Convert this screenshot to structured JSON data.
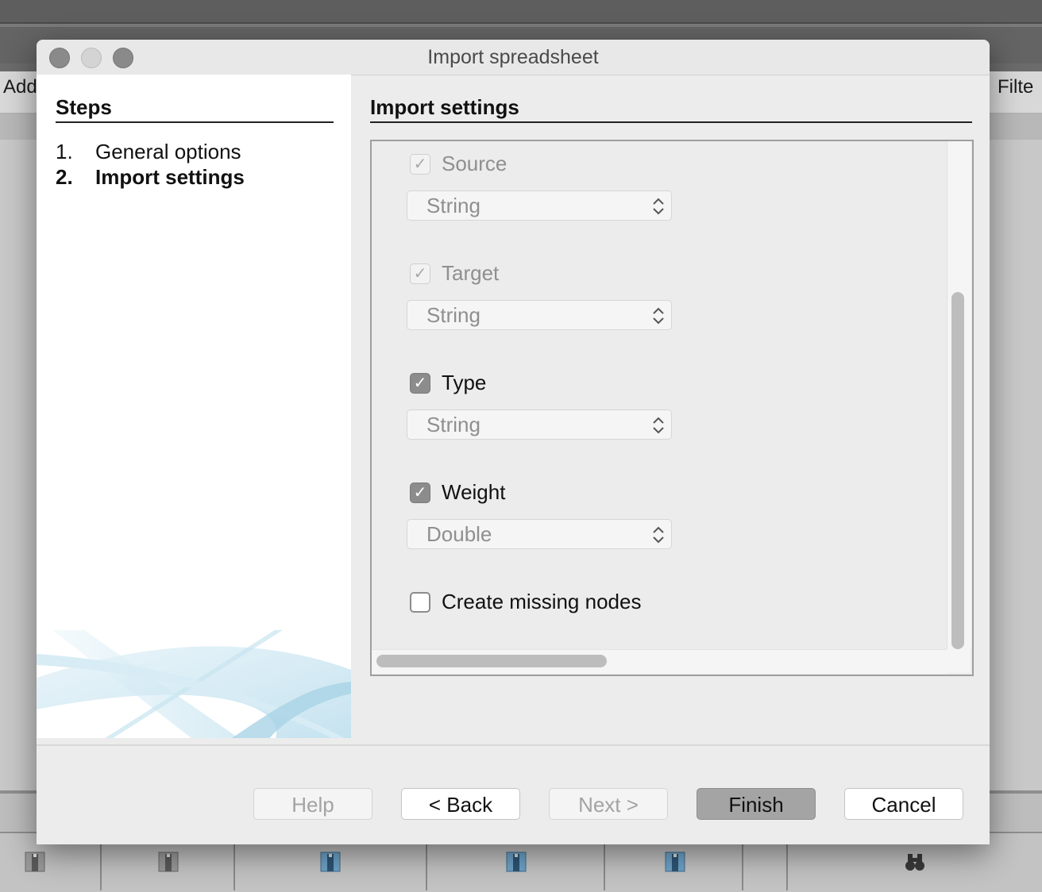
{
  "background": {
    "toolbar_left": "Add",
    "toolbar_right": "Filte"
  },
  "dialog": {
    "title": "Import spreadsheet",
    "steps": {
      "heading": "Steps",
      "items": [
        {
          "number": "1.",
          "label": "General options",
          "active": false
        },
        {
          "number": "2.",
          "label": "Import settings",
          "active": true
        }
      ]
    },
    "settings": {
      "heading": "Import settings",
      "columns": [
        {
          "label": "Source",
          "checked": true,
          "enabled": false,
          "type": "String"
        },
        {
          "label": "Target",
          "checked": true,
          "enabled": false,
          "type": "String"
        },
        {
          "label": "Type",
          "checked": true,
          "enabled": true,
          "type": "String"
        },
        {
          "label": "Weight",
          "checked": true,
          "enabled": true,
          "type": "Double"
        }
      ],
      "create_missing_nodes": {
        "label": "Create missing nodes",
        "checked": false
      }
    },
    "buttons": {
      "help": "Help",
      "back": "< Back",
      "next": "Next >",
      "finish": "Finish",
      "cancel": "Cancel"
    }
  },
  "colors": {
    "dialog_bg": "#ececec",
    "checkbox_checked": "#8c8c8c",
    "finish_button": "#a4a4a4"
  }
}
